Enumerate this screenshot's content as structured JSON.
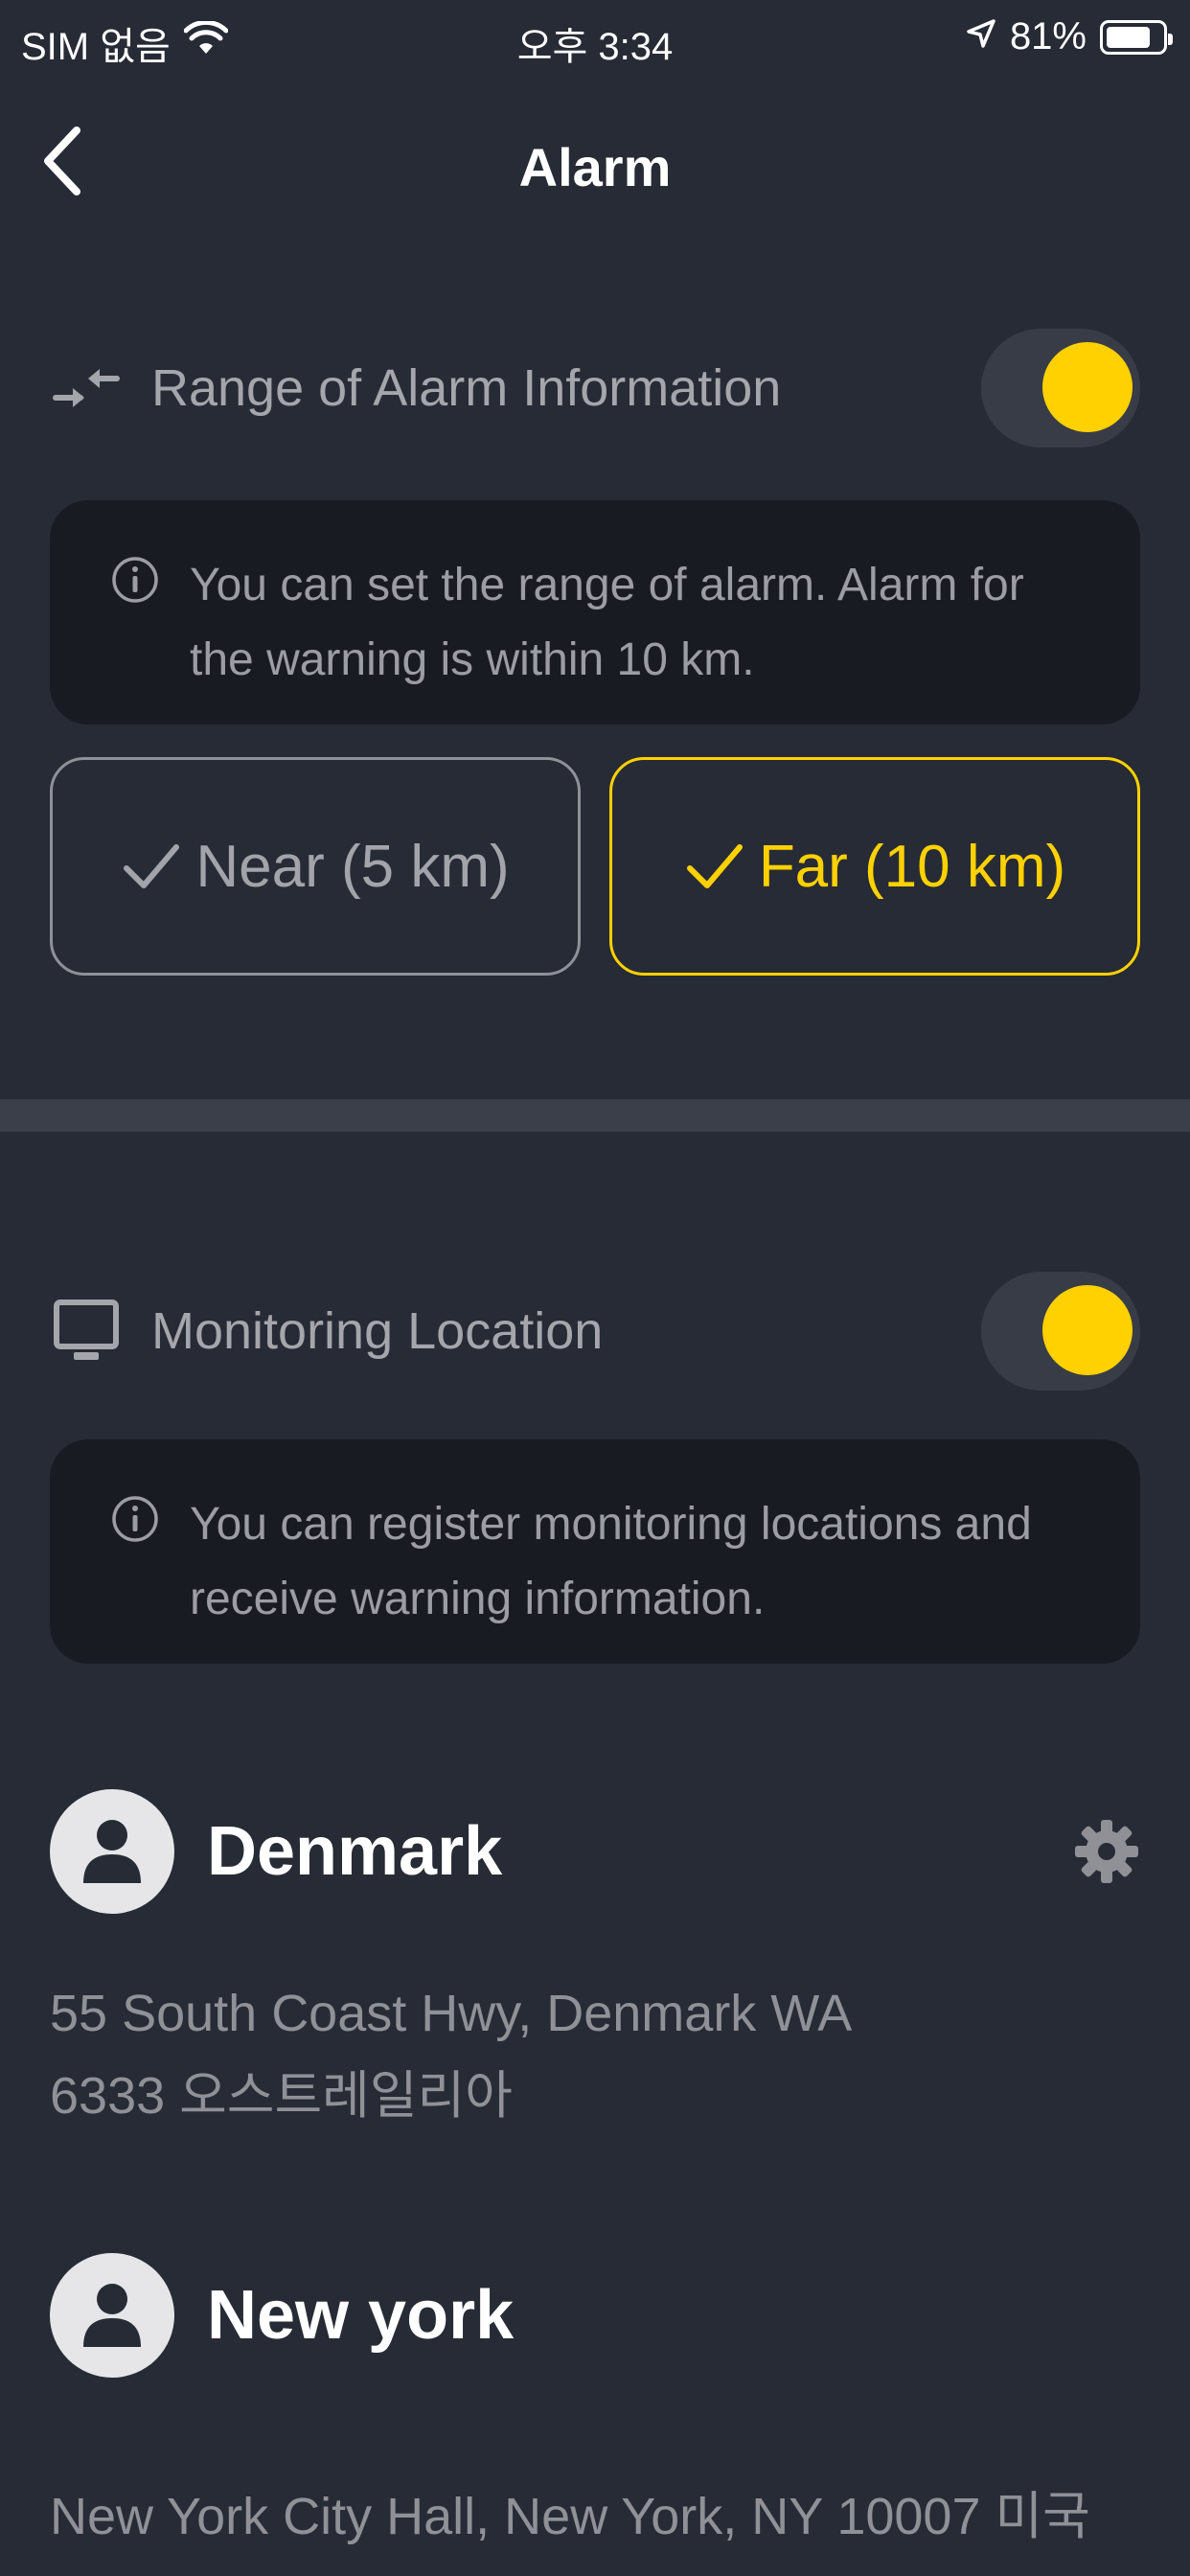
{
  "status_bar": {
    "carrier": "SIM 없음",
    "time": "오후 3:34",
    "battery_percent": "81%",
    "battery_level": 0.81
  },
  "header": {
    "title": "Alarm",
    "back_icon": "chevron-left-icon"
  },
  "range_section": {
    "label": "Range of Alarm Information",
    "icon": "arrows-compress-icon",
    "toggle_on": true,
    "info": "You can set the range of alarm. Alarm for the warning is within 10 km.",
    "options": [
      {
        "label": "Near (5 km)",
        "selected": false
      },
      {
        "label": "Far (10 km)",
        "selected": true
      }
    ]
  },
  "monitoring_section": {
    "label": "Monitoring Location",
    "icon": "monitor-icon",
    "toggle_on": true,
    "info": "You can register monitoring locations and receive warning information."
  },
  "locations": [
    {
      "name": "Denmark",
      "address_line1": "55 South Coast Hwy, Denmark WA",
      "address_line2": "6333 오스트레일리아",
      "settings_icon": "gear-icon"
    },
    {
      "name": "New york",
      "address_line1": "New York City Hall, New York, NY 10007 미국"
    }
  ],
  "colors": {
    "background": "#272b35",
    "accent": "#ffd100",
    "panel": "#181b22",
    "divider": "#3b3f4a"
  }
}
